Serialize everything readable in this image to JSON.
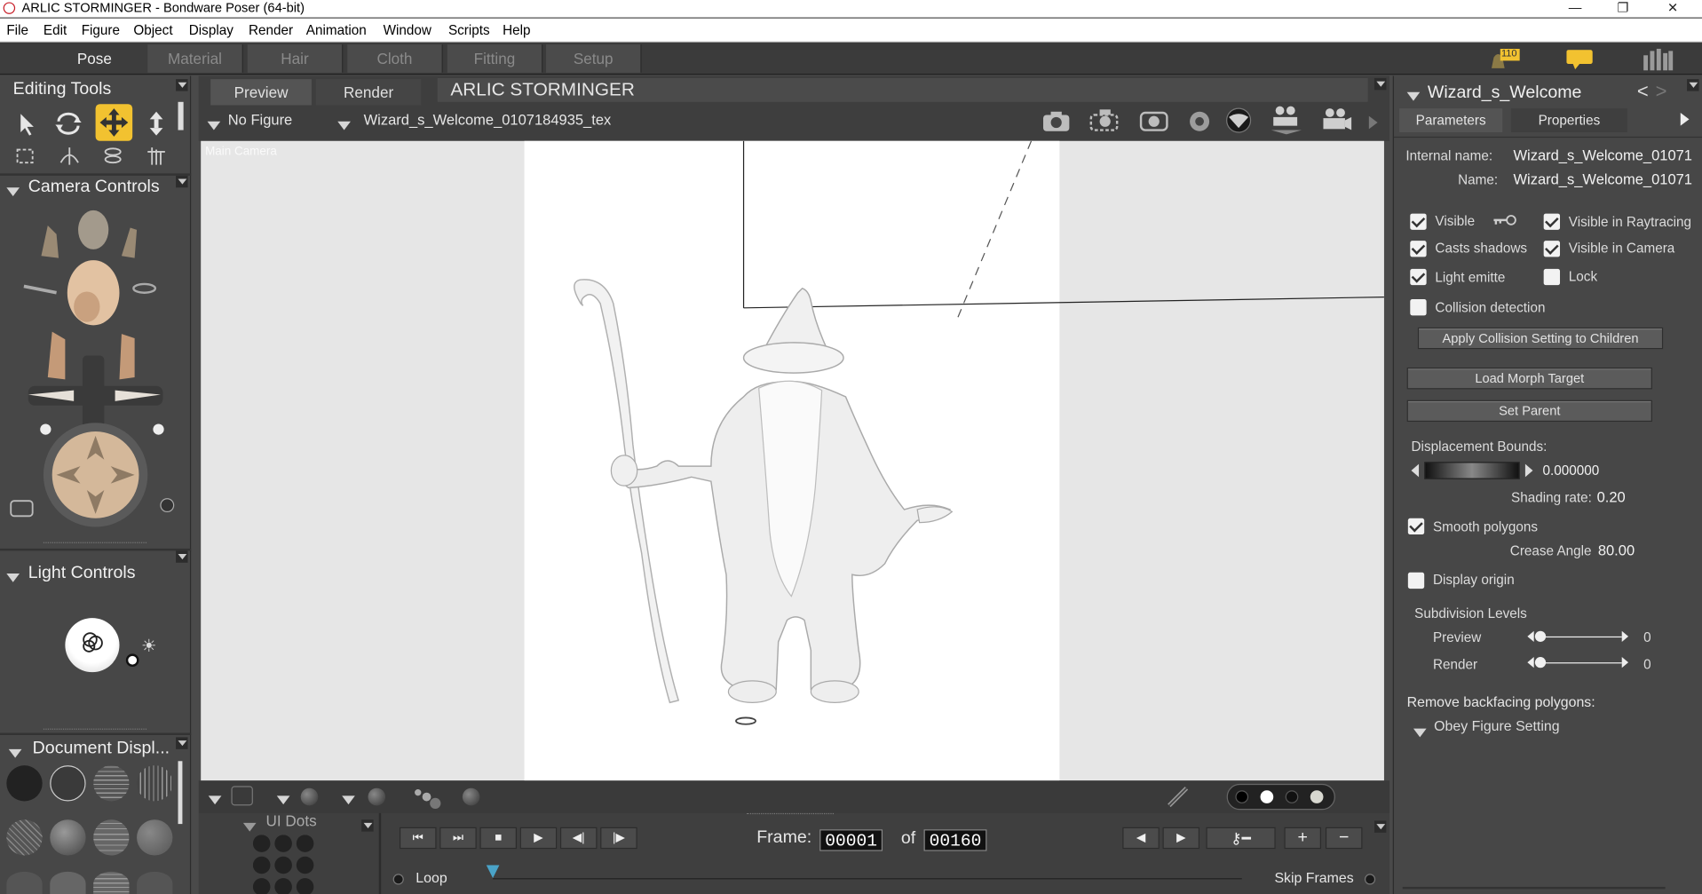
{
  "window": {
    "title": "ARLIC STORMINGER - Bondware Poser (64-bit)",
    "controls": [
      "—",
      "❐",
      "✕"
    ]
  },
  "menu": [
    "File",
    "Edit",
    "Figure",
    "Object",
    "Display",
    "Render",
    "Animation",
    "Window",
    "Scripts",
    "Help"
  ],
  "rooms": [
    "Pose",
    "Material",
    "Hair",
    "Cloth",
    "Fitting",
    "Setup"
  ],
  "active_room": "Pose",
  "notifications": {
    "badge": "110"
  },
  "left": {
    "editing_tools_title": "Editing Tools",
    "camera_controls_title": "Camera Controls",
    "light_controls_title": "Light Controls",
    "document_display_title": "Document  Displ...",
    "ui_dots_title": "UI Dots"
  },
  "viewport": {
    "tabs": [
      "Preview",
      "Render"
    ],
    "scene_title": "ARLIC STORMINGER",
    "figure_select": "No Figure",
    "object_select": "Wizard_s_Welcome_0107184935_tex",
    "camera_label": "Main Camera"
  },
  "timeline": {
    "frame_label": "Frame:",
    "frame_value": "00001",
    "of_label": "of",
    "total_frames": "00160",
    "loop_label": "Loop",
    "skip_frames_label": "Skip Frames"
  },
  "right": {
    "title": "Wizard_s_Welcome",
    "tabs": [
      "Parameters",
      "Properties"
    ],
    "active_tab": "Properties",
    "internal_name_label": "Internal name:",
    "internal_name_value": "Wizard_s_Welcome_01071",
    "name_label": "Name:",
    "name_value": "Wizard_s_Welcome_01071",
    "checks": {
      "visible": {
        "label": "Visible",
        "checked": true
      },
      "visible_raytracing": {
        "label": "Visible in Raytracing",
        "checked": true
      },
      "casts_shadows": {
        "label": "Casts shadows",
        "checked": true
      },
      "visible_camera": {
        "label": "Visible in Camera",
        "checked": true
      },
      "light_emitter": {
        "label": "Light emitte",
        "checked": true
      },
      "lock": {
        "label": "Lock",
        "checked": false
      },
      "collision_detection": {
        "label": "Collision detection",
        "checked": false
      },
      "smooth_polygons": {
        "label": "Smooth polygons",
        "checked": true
      },
      "display_origin": {
        "label": "Display origin",
        "checked": false
      }
    },
    "apply_collision_button": "Apply Collision Setting to Children",
    "load_morph_button": "Load Morph Target",
    "set_parent_button": "Set Parent",
    "displacement_bounds_label": "Displacement Bounds:",
    "displacement_bounds_value": "0.000000",
    "shading_rate_label": "Shading rate:",
    "shading_rate_value": "0.20",
    "crease_angle_label": "Crease Angle",
    "crease_angle_value": "80.00",
    "subdivision_title": "Subdivision Levels",
    "preview_label": "Preview",
    "preview_value": "0",
    "render_label": "Render",
    "render_value": "0",
    "remove_backfacing_label": "Remove backfacing polygons:",
    "obey_label": "Obey Figure Setting"
  },
  "colors": {
    "accent": "#f2c230",
    "panel": "#474747",
    "viewport_bg": "#e6e6e6"
  }
}
